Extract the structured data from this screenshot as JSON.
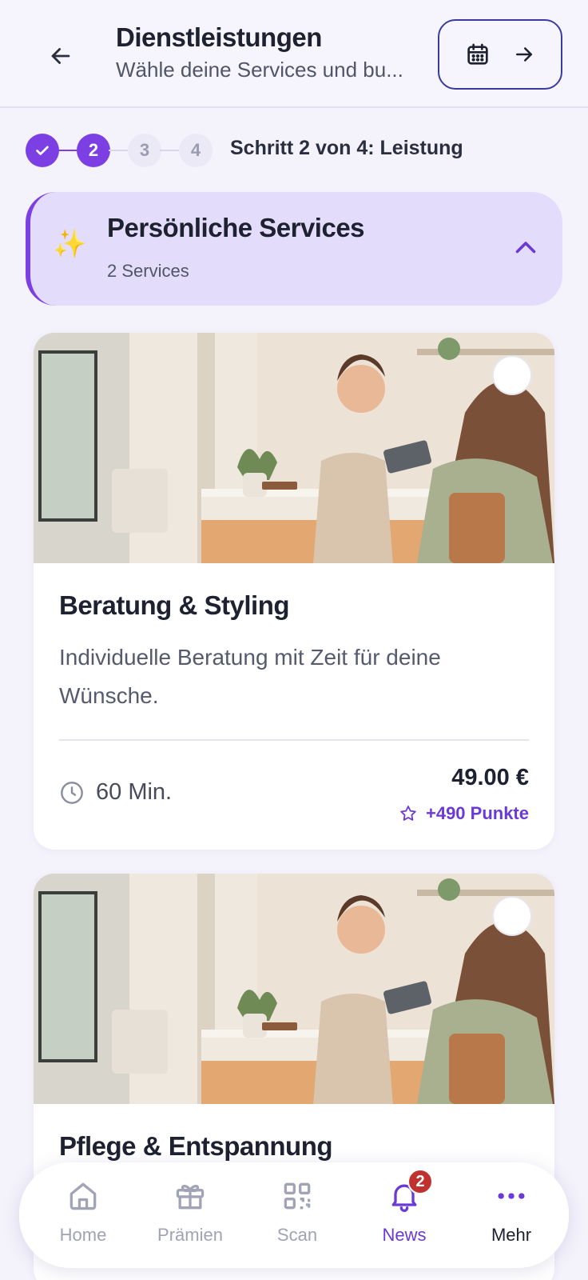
{
  "header": {
    "title": "Dienstleistungen",
    "subtitle": "Wähle deine Services und bu..."
  },
  "stepper": {
    "steps": [
      "✓",
      "2",
      "3",
      "4"
    ],
    "current": 2,
    "total": 4,
    "label": "Schritt 2 von 4: Leistung"
  },
  "category": {
    "icon": "✨",
    "title": "Persönliche Services",
    "count": "2 Services"
  },
  "services": [
    {
      "title": "Beratung & Styling",
      "description": "Individuelle Beratung mit Zeit für deine Wünsche.",
      "duration": "60 Min.",
      "price": "49.00 €",
      "points": "+490 Punkte"
    },
    {
      "title": "Pflege & Entspannung"
    }
  ],
  "nav": {
    "home": "Home",
    "rewards": "Prämien",
    "scan": "Scan",
    "news": "News",
    "news_badge": "2",
    "more": "Mehr"
  },
  "colors": {
    "accent": "#7b3fe4",
    "accent_text": "#6b3ad6",
    "category_bg": "#e4dcfb",
    "badge": "#c0322f"
  }
}
